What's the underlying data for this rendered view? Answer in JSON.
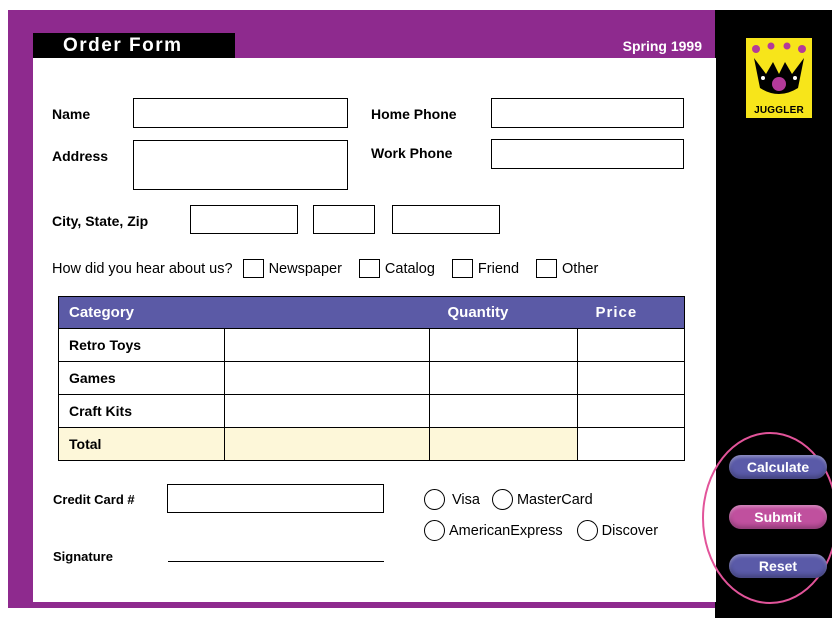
{
  "header": {
    "title": "Order Form",
    "season": "Spring 1999"
  },
  "logo": {
    "text": "JUGGLER",
    "icon": "jester-crown-icon"
  },
  "form": {
    "name_label": "Name",
    "address_label": "Address",
    "home_phone_label": "Home Phone",
    "work_phone_label": "Work Phone",
    "city_state_zip_label": "City, State, Zip",
    "hear_about": {
      "question": "How did you hear about us?",
      "options": [
        "Newspaper",
        "Catalog",
        "Friend",
        "Other"
      ]
    }
  },
  "table": {
    "headers": [
      "Category",
      "Quantity",
      "Price"
    ],
    "rows": [
      "Retro Toys",
      "Games",
      "Craft Kits"
    ],
    "total_label": "Total"
  },
  "payment": {
    "credit_card_label": "Credit Card #",
    "signature_label": "Signature",
    "card_types": [
      "Visa",
      "MasterCard",
      "AmericanExpress",
      "Discover"
    ]
  },
  "buttons": {
    "calculate": "Calculate",
    "submit": "Submit",
    "reset": "Reset"
  },
  "colors": {
    "frame": "#8e2a8e",
    "table_header": "#5b5aa6",
    "total_row": "#fdf7d9",
    "logo_bg": "#f7e51a",
    "ring": "#e2549a"
  }
}
